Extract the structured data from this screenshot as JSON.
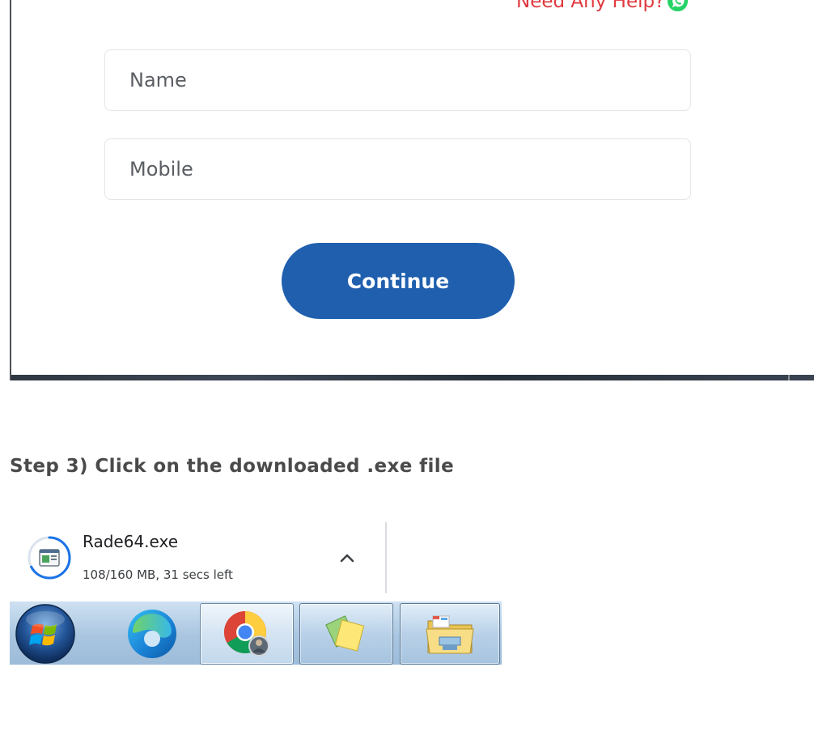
{
  "form": {
    "help_text": "Need Any Help?",
    "name_placeholder": "Name",
    "mobile_placeholder": "Mobile",
    "continue_label": "Continue",
    "brand_color": "#1f5fae",
    "help_color": "#e0393e"
  },
  "step": {
    "heading": "Step 3) Click on the downloaded .exe file"
  },
  "download": {
    "filename": "Rade64.exe",
    "status": "108/160 MB, 31 secs left",
    "icon": "installer-file-icon",
    "progress": 0.675
  },
  "taskbar": {
    "items": [
      {
        "name": "windows-start-icon"
      },
      {
        "name": "edge-icon"
      },
      {
        "name": "chrome-icon"
      },
      {
        "name": "sticky-notes-icon"
      },
      {
        "name": "file-explorer-icon"
      }
    ]
  }
}
